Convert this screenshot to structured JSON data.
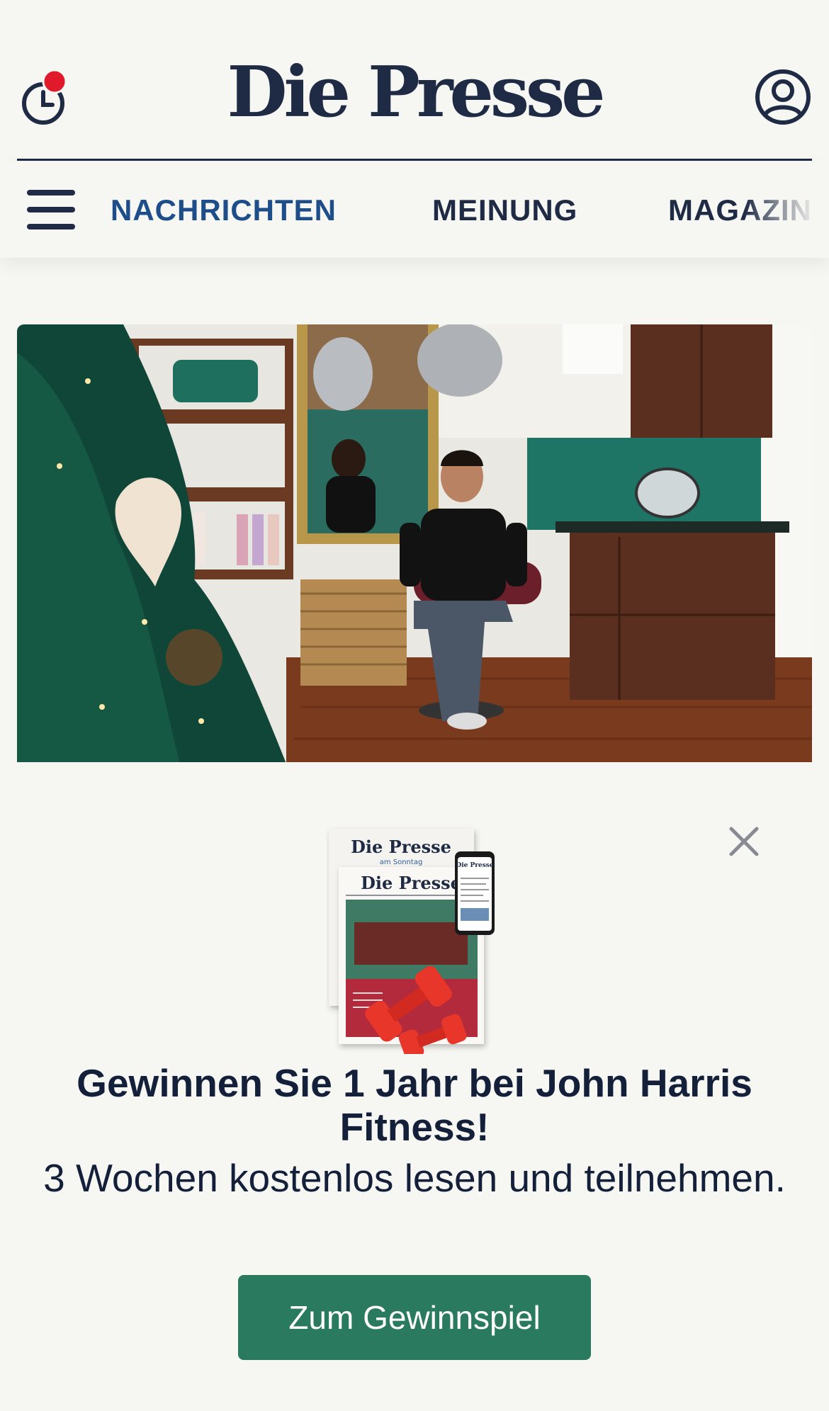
{
  "header": {
    "logo": "Die Presse",
    "notification_color": "#e0192b"
  },
  "nav": {
    "items": [
      {
        "label": "NACHRICHTEN",
        "active": true
      },
      {
        "label": "MEINUNG",
        "active": false
      },
      {
        "label": "MAGAZIN",
        "active": false
      }
    ]
  },
  "hero": {
    "icons": [
      "christmas-tree",
      "salon-interior",
      "man-in-chair"
    ]
  },
  "promo": {
    "illustration": {
      "paper_back_title": "Die Presse",
      "paper_back_subtitle": "am Sonntag",
      "paper_front_title": "Die Presse",
      "phone_title": "Die Presse",
      "icon": "dumbbells"
    },
    "title": "Gewinnen Sie 1 Jahr bei John Harris Fitness!",
    "subtitle": "3 Wochen kostenlos lesen und teilnehmen.",
    "cta_label": "Zum Gewinnspiel",
    "cta_color": "#2a7a5f"
  }
}
